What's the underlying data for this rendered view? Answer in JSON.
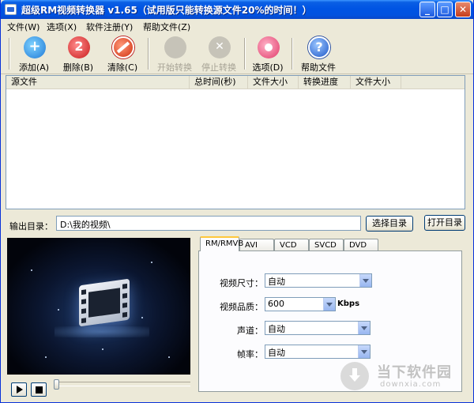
{
  "window": {
    "title": "超级RM视频转换器 v1.65（试用版只能转换源文件20%的时间！）"
  },
  "menu": [
    {
      "label": "文件(W)"
    },
    {
      "label": "选项(X)"
    },
    {
      "label": "软件注册(Y)"
    },
    {
      "label": "帮助文件(Z)"
    }
  ],
  "toolbar": {
    "add": "添加(A)",
    "delete": "删除(B)",
    "clear": "清除(C)",
    "start": "开始转换",
    "stop": "停止转换",
    "options": "选项(D)",
    "help": "帮助文件"
  },
  "file_list": {
    "columns": [
      "源文件",
      "总时间(秒)",
      "文件大小",
      "转换进度",
      "文件大小"
    ]
  },
  "output": {
    "label": "输出目录：",
    "path": "D:\\我的视频\\",
    "choose_button": "选择目录",
    "open_button": "打开目录"
  },
  "tabs": [
    "RM/RMVB",
    "AVI",
    "VCD",
    "SVCD",
    "DVD"
  ],
  "settings": {
    "video_size_label": "视频尺寸：",
    "video_size_value": "自动",
    "video_quality_label": "视频品质：",
    "video_quality_value": "600",
    "video_quality_unit": "Kbps",
    "channel_label": "声道：",
    "channel_value": "自动",
    "framerate_label": "帧率：",
    "framerate_value": "自动"
  },
  "watermark": {
    "title": "当下软件园",
    "url": "downxia.com"
  },
  "colors": {
    "titlebar": "#0054e3",
    "window_bg": "#ece9d8",
    "tab_highlight": "#ffc83c"
  }
}
